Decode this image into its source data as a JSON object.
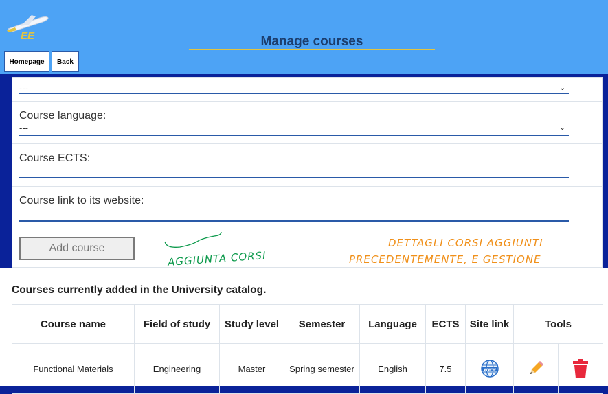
{
  "header": {
    "title": "Manage courses",
    "logo_text": "EE",
    "nav": {
      "home_label": "Homepage",
      "back_label": "Back"
    }
  },
  "form": {
    "first_select_value": "---",
    "language": {
      "label": "Course language:",
      "value": "---"
    },
    "ects": {
      "label": "Course ECTS:"
    },
    "link": {
      "label": "Course link to its website:"
    },
    "add_button_label": "Add course"
  },
  "annotations": {
    "add_note": "AGGIUNTA CORSI",
    "details_note_line1": "DETTAGLI CORSI AGGIUNTI",
    "details_note_line2": "PRECEDENTEMENTE, E GESTIONE"
  },
  "catalog": {
    "title": "Courses currently added in the University catalog.",
    "columns": [
      "Course name",
      "Field of study",
      "Study level",
      "Semester",
      "Language",
      "ECTS",
      "Site link",
      "Tools"
    ],
    "rows": [
      {
        "name": "Functional Materials",
        "field": "Engineering",
        "level": "Master",
        "semester": "Spring semester",
        "language": "English",
        "ects": "7.5"
      }
    ]
  },
  "colors": {
    "frame": "#0a2299",
    "header": "#4da3f5",
    "accent_line": "#e2c441",
    "field_underline": "#2a5aa8",
    "annotation_green": "#0d9a4c",
    "annotation_orange": "#f0901a",
    "delete_red": "#e8283c",
    "edit_orange": "#f5a623"
  },
  "icons": [
    "airplane-logo-icon",
    "chevron-down-icon",
    "globe-www-icon",
    "pencil-icon",
    "trash-icon"
  ]
}
